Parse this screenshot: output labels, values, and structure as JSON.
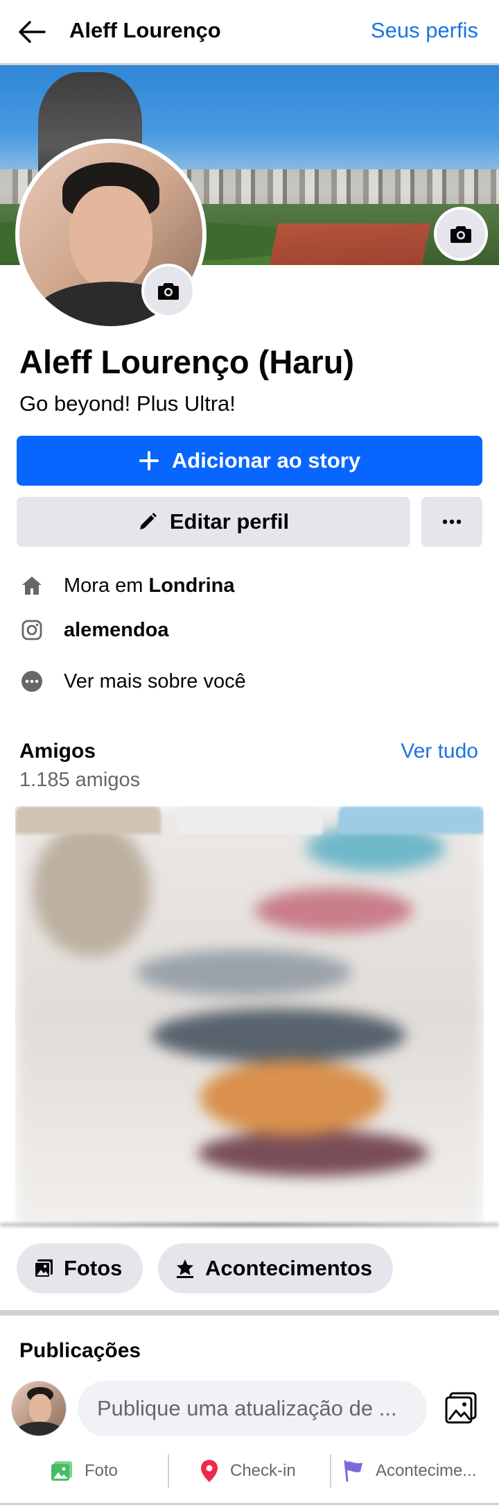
{
  "header": {
    "title": "Aleff Lourenço",
    "profiles_link": "Seus perfis"
  },
  "profile": {
    "name": "Aleff Lourenço (Haru)",
    "bio": "Go beyond! Plus Ultra!"
  },
  "buttons": {
    "add_story": "Adicionar ao story",
    "edit_profile": "Editar perfil"
  },
  "details": {
    "lives_prefix": "Mora em ",
    "lives_city": "Londrina",
    "instagram": "alemendoa",
    "see_more": "Ver mais sobre você"
  },
  "friends": {
    "title": "Amigos",
    "count": "1.185 amigos",
    "see_all": "Ver tudo"
  },
  "chips": {
    "photos": "Fotos",
    "events": "Acontecimentos"
  },
  "posts": {
    "title": "Publicações",
    "composer_placeholder": "Publique uma atualização de ...",
    "actions": {
      "photo": "Foto",
      "checkin": "Check-in",
      "events": "Acontecime..."
    }
  },
  "colors": {
    "accent": "#0866ff",
    "link": "#1b74e4",
    "button_gray": "#e4e6eb",
    "secondary_text": "#65676b",
    "photo_icon": "#45bd62",
    "checkin_icon": "#f02849",
    "events_icon": "#7b6ad8"
  },
  "icons": [
    "back-arrow-icon",
    "camera-icon",
    "plus-icon",
    "pencil-icon",
    "more-dots-icon",
    "home-icon",
    "instagram-icon",
    "ellipsis-circle-icon",
    "photos-icon",
    "star-icon",
    "image-add-icon",
    "location-pin-icon",
    "flag-icon"
  ]
}
